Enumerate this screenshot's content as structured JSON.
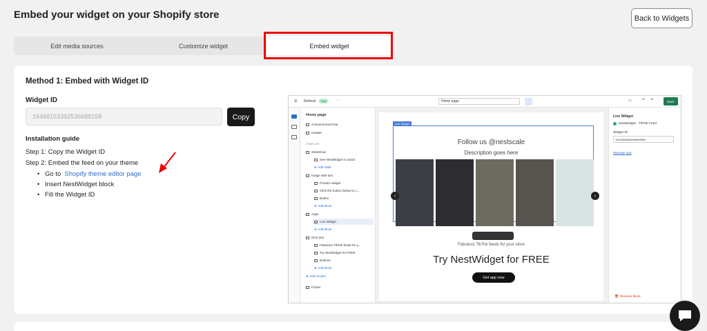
{
  "header": {
    "title": "Embed your widget on your Shopify store",
    "back_label": "Back to Widgets"
  },
  "tabs": [
    {
      "label": "Edit media sources",
      "active": false
    },
    {
      "label": "Customize widget",
      "active": false
    },
    {
      "label": "Embed widget",
      "active": true
    }
  ],
  "method": {
    "title": "Method 1: Embed with Widget ID",
    "widget_id_label": "Widget ID",
    "widget_id_value": "16468153392536688158",
    "copy_label": "Copy",
    "guide_title": "Installation guide",
    "step1": "Step 1: Copy the Widget ID",
    "step2": "Step 2: Embed the feed on your theme",
    "bullet1_prefix": "Go to",
    "bullet1_link": "Shopify theme editor page",
    "bullet2": "Insert NestWidget block",
    "bullet3": "Fill the Widget ID"
  },
  "screenshot": {
    "top": {
      "refresh": "Refresh",
      "live": "Live",
      "page_select": "Home page",
      "save": "Save"
    },
    "nav": {
      "title": "Home page",
      "items": [
        "Announcement bar",
        "Header",
        "TEMPLATE",
        "Slideshow",
        "See NestWidget in action",
        "Add Slide",
        "Image with text",
        "Product widget",
        "Click the button below to c...",
        "Button",
        "Add block",
        "Apps",
        "Live Widget",
        "Add block",
        "Rich text",
        "Fabulous TikTok feeds for y...",
        "Try NestWidget for FREE",
        "Buttons",
        "Add block",
        "Add section",
        "Footer"
      ]
    },
    "canvas": {
      "tag": "Live Widget",
      "follow": "Follow us @nestscale",
      "description": "Description goes here",
      "tagline": "Fabulous TikTok feeds for your store",
      "cta_title": "Try NestWidget for FREE",
      "cta_button": "Get app now"
    },
    "right": {
      "title": "Live Widget",
      "subtitle": "NestWidget - TikTok Feed",
      "field_label": "Widget ID",
      "field_value": "16126560062809699895",
      "manage": "Manage app",
      "remove": "Remove block"
    }
  }
}
